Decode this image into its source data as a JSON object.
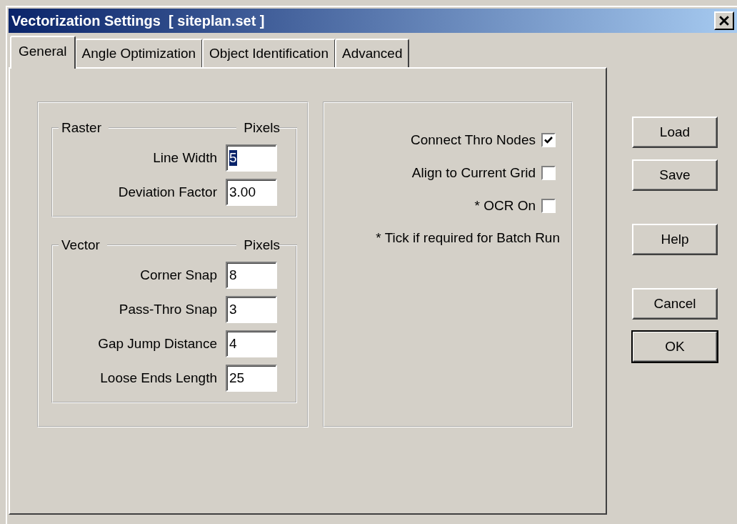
{
  "window": {
    "title": "Vectorization Settings  [ siteplan.set ]"
  },
  "tabs": [
    {
      "label": "General",
      "selected": true
    },
    {
      "label": "Angle Optimization",
      "selected": false
    },
    {
      "label": "Object Identification",
      "selected": false
    },
    {
      "label": "Advanced",
      "selected": false
    }
  ],
  "groups": [
    {
      "title": "Raster",
      "unit": "Pixels",
      "fields": [
        {
          "label": "Line Width",
          "value": "5",
          "selected": true
        },
        {
          "label": "Deviation Factor",
          "value": "3.00",
          "selected": false
        }
      ]
    },
    {
      "title": "Vector",
      "unit": "Pixels",
      "fields": [
        {
          "label": "Corner Snap",
          "value": "8",
          "selected": false
        },
        {
          "label": "Pass-Thro Snap",
          "value": "3",
          "selected": false
        },
        {
          "label": "Gap Jump Distance",
          "value": "4",
          "selected": false
        },
        {
          "label": "Loose Ends Length",
          "value": "25",
          "selected": false
        }
      ]
    }
  ],
  "options": [
    {
      "label": "Connect Thro Nodes",
      "checked": true
    },
    {
      "label": "Align to Current Grid",
      "checked": false
    },
    {
      "label": "* OCR On",
      "checked": false
    }
  ],
  "note": "* Tick if required for Batch Run",
  "button_groups": [
    [
      {
        "label": "Load",
        "default": false
      },
      {
        "label": "Save",
        "default": false
      }
    ],
    [
      {
        "label": "Help",
        "default": false
      }
    ],
    [
      {
        "label": "Cancel",
        "default": false
      },
      {
        "label": "OK",
        "default": true
      }
    ]
  ]
}
